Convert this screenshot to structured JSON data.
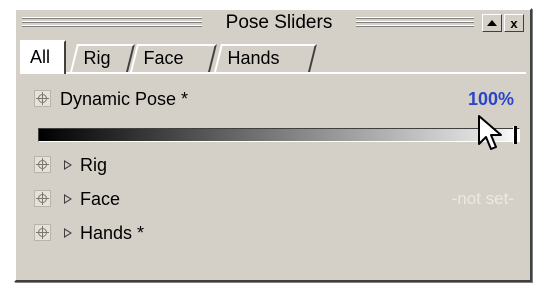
{
  "window": {
    "title": "Pose Sliders"
  },
  "titlebar_buttons": {
    "minimize_icon": "triangle-up-icon",
    "close_label": "x"
  },
  "tabs": [
    {
      "label": "All",
      "active": true
    },
    {
      "label": "Rig",
      "active": false
    },
    {
      "label": "Face",
      "active": false
    },
    {
      "label": "Hands",
      "active": false
    }
  ],
  "rows": {
    "dynamic_pose": {
      "label": "Dynamic Pose *",
      "value": "100%",
      "slider_fraction": 1.0
    },
    "rig": {
      "label": "Rig"
    },
    "face": {
      "label": "Face",
      "value": "-not set-"
    },
    "hands": {
      "label": "Hands *"
    }
  },
  "colors": {
    "value_accent": "#2b45c8",
    "face_bg": "#d4d0c8"
  }
}
